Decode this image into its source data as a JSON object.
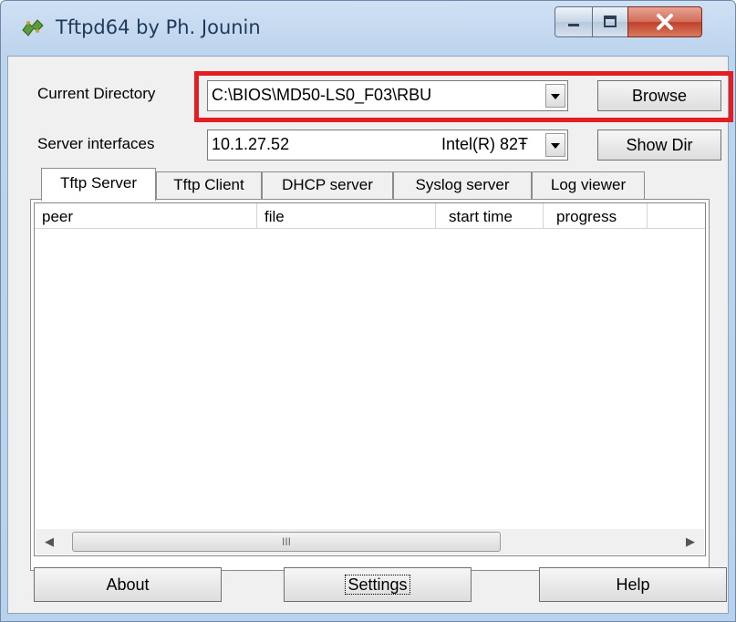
{
  "window": {
    "title": "Tftpd64 by Ph. Jounin"
  },
  "settings": {
    "current_directory_label": "Current Directory",
    "current_directory_value": "C:\\BIOS\\MD50-LS0_F03\\RBU",
    "server_interfaces_label": "Server interfaces",
    "server_interface_ip": "10.1.27.52",
    "server_interface_adapter": "Intel(R) 82Ŧ",
    "browse_button": "Browse",
    "show_dir_button": "Show Dir"
  },
  "tabs": [
    {
      "label": "Tftp Server",
      "active": true
    },
    {
      "label": "Tftp Client",
      "active": false
    },
    {
      "label": "DHCP server",
      "active": false
    },
    {
      "label": "Syslog server",
      "active": false
    },
    {
      "label": "Log viewer",
      "active": false
    }
  ],
  "table": {
    "columns": [
      "peer",
      "file",
      "start time",
      "progress"
    ],
    "rows": []
  },
  "scrollbar": {
    "thumb_grip": "III"
  },
  "bottom_buttons": {
    "about": "About",
    "settings": "Settings",
    "help": "Help"
  },
  "colors": {
    "highlight_box": "#e41d23",
    "title_text": "#1e3a5a",
    "close_button": "#c0402a"
  },
  "icons": [
    "tftpd-app-icon",
    "minimize-icon",
    "maximize-icon",
    "close-icon",
    "dropdown-arrow-icon",
    "scroll-left-icon",
    "scroll-right-icon"
  ]
}
